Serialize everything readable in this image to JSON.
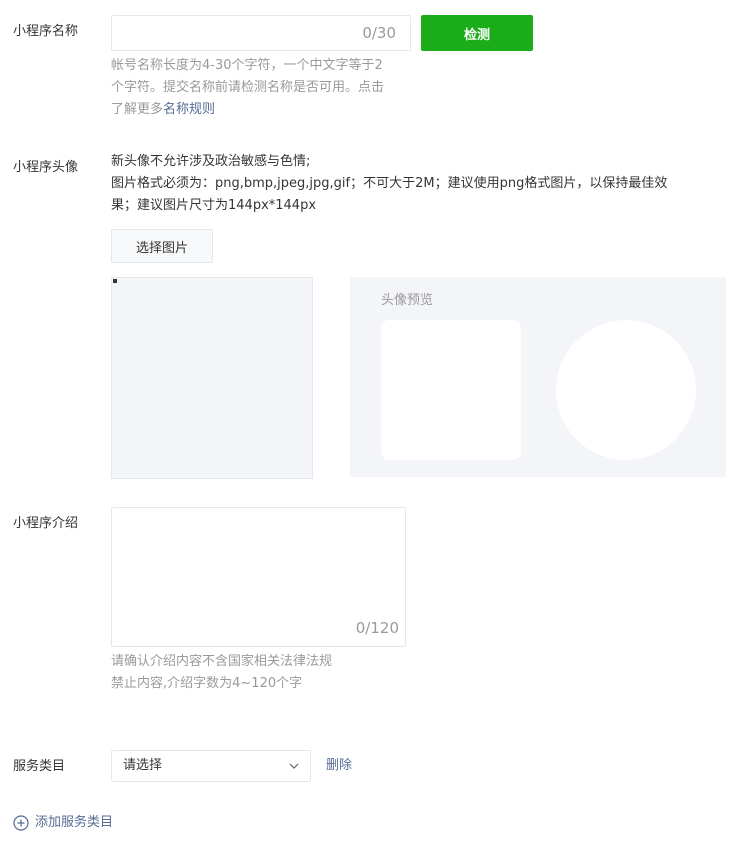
{
  "name_section": {
    "label": "小程序名称",
    "counter": "0/30",
    "check_button": "检测",
    "hint_line1": "帐号名称长度为4-30个字符，一个中文字等于2",
    "hint_line2": "个字符。提交名称前请检测名称是否可用。点击",
    "hint_line3_prefix": "了解更多",
    "hint_line3_link": "名称规则"
  },
  "avatar_section": {
    "label": "小程序头像",
    "desc_line1": "新头像不允许涉及政治敏感与色情;",
    "desc_line2": "图片格式必须为：png,bmp,jpeg,jpg,gif；不可大于2M；建议使用png格式图片，以保持最佳效",
    "desc_line3": "果；建议图片尺寸为144px*144px",
    "choose_button": "选择图片",
    "preview_title": "头像预览"
  },
  "intro_section": {
    "label": "小程序介绍",
    "counter": "0/120",
    "hint_line1": "请确认介绍内容不含国家相关法律法规",
    "hint_line2": "禁止内容,介绍字数为4~120个字"
  },
  "category_section": {
    "label": "服务类目",
    "select_value": "请选择",
    "delete_link": "删除",
    "add_link": "添加服务类目"
  },
  "icons": {
    "chevron": "chevron-down-icon",
    "add": "plus-circle-icon"
  },
  "colors": {
    "primary_green": "#1aad19",
    "link_blue": "#576b95",
    "hint_gray": "#9a9a9a",
    "border": "#e4e8eb"
  }
}
